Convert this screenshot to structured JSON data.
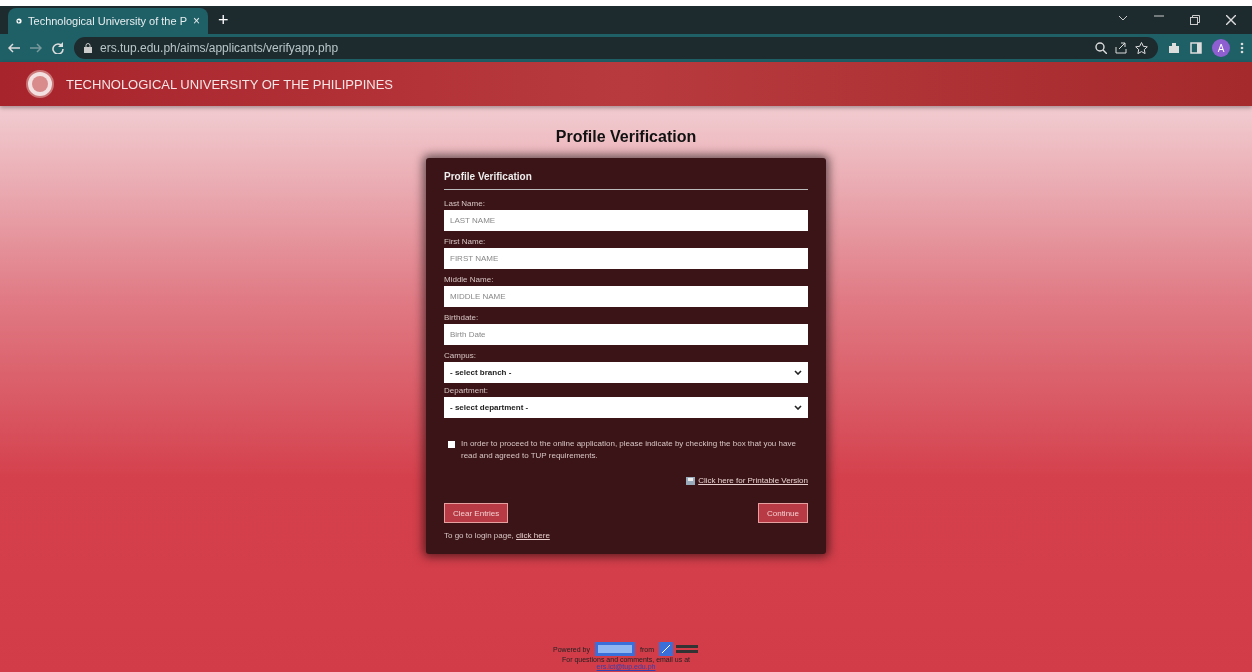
{
  "browser": {
    "tab": {
      "title": "Technological University of the P",
      "close": "×"
    },
    "new_tab": "+",
    "url": "ers.tup.edu.ph/aims/applicants/verifyapp.php",
    "avatar": "A"
  },
  "header": {
    "title": "TECHNOLOGICAL UNIVERSITY OF THE PHILIPPINES"
  },
  "page_title": "Profile Verification",
  "form": {
    "title": "Profile Verification",
    "fields": [
      {
        "kind": "text",
        "label": "Last Name:",
        "placeholder": "LAST NAME"
      },
      {
        "kind": "text",
        "label": "First Name:",
        "placeholder": "FIRST NAME"
      },
      {
        "kind": "text",
        "label": "Middle Name:",
        "placeholder": "MIDDLE NAME"
      },
      {
        "kind": "text",
        "label": "Birthdate:",
        "placeholder": "Birth Date"
      },
      {
        "kind": "select",
        "label": "Campus:",
        "value": "- select branch -"
      },
      {
        "kind": "select",
        "label": "Department:",
        "value": "- select department -"
      }
    ],
    "agreement": {
      "checked": false,
      "text": "In order to proceed to the online application, please indicate by checking the box that you have read and agreed to TUP requirements."
    },
    "printable_link": "Click here for Printable Version",
    "clear_button": "Clear Entries",
    "continue_button": "Continue",
    "login_note": "To go to login page, ",
    "login_link": "click here"
  },
  "footer": {
    "powered_by": "Powered by",
    "from": "from",
    "contact": "For questions and comments, email us at",
    "email": "ers.ict@tup.edu.ph"
  }
}
